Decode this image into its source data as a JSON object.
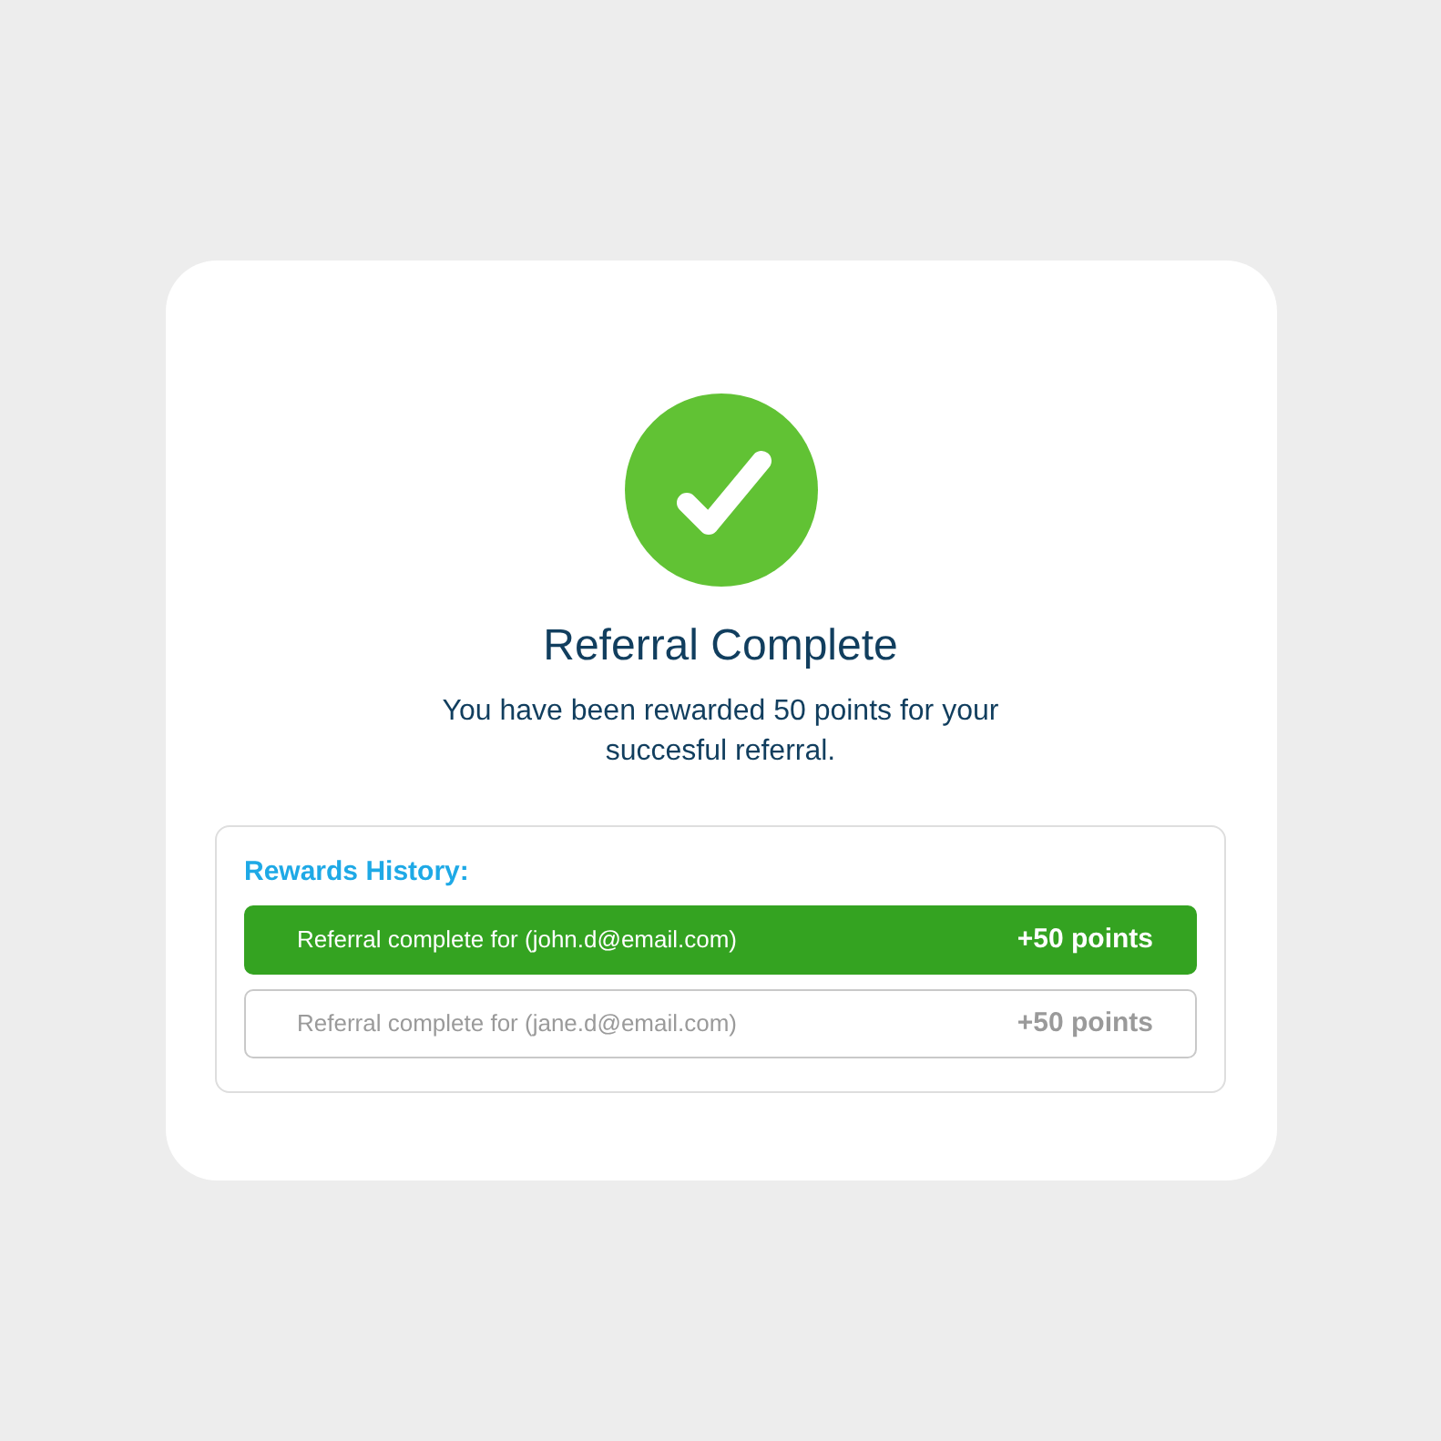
{
  "title": "Referral Complete",
  "message": "You have been rewarded 50 points for your succesful referral.",
  "history": {
    "heading": "Rewards History:",
    "rows": [
      {
        "text": "Referral complete for (john.d@email.com)",
        "points": "+50 points",
        "highlighted": true
      },
      {
        "text": "Referral complete for (jane.d@email.com)",
        "points": "+50 points",
        "highlighted": false
      }
    ]
  }
}
